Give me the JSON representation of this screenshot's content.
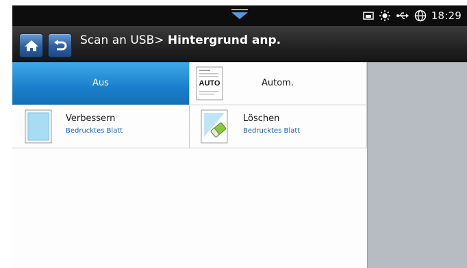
{
  "status_bar": {
    "time": "18:29",
    "icons": [
      "pulldown-arrow-icon",
      "memory-card-icon",
      "brightness-icon",
      "usb-icon",
      "globe-icon"
    ]
  },
  "header": {
    "breadcrumb": "Scan an USB>",
    "title": "Hintergrund anp.",
    "home_icon": "home-icon",
    "back_icon": "back-icon"
  },
  "options": [
    {
      "label": "Aus",
      "selected": true
    },
    {
      "label": "Autom.",
      "icon_text": "AUTO",
      "selected": false
    },
    {
      "label": "Verbessern",
      "sublabel": "Bedrucktes Blatt",
      "selected": false
    },
    {
      "label": "Löschen",
      "sublabel": "Bedrucktes Blatt",
      "selected": false
    }
  ],
  "colors": {
    "selected_tile": "#1a7fcb",
    "sublabel": "#1a5fb5",
    "side_panel": "#b7bcc2"
  }
}
